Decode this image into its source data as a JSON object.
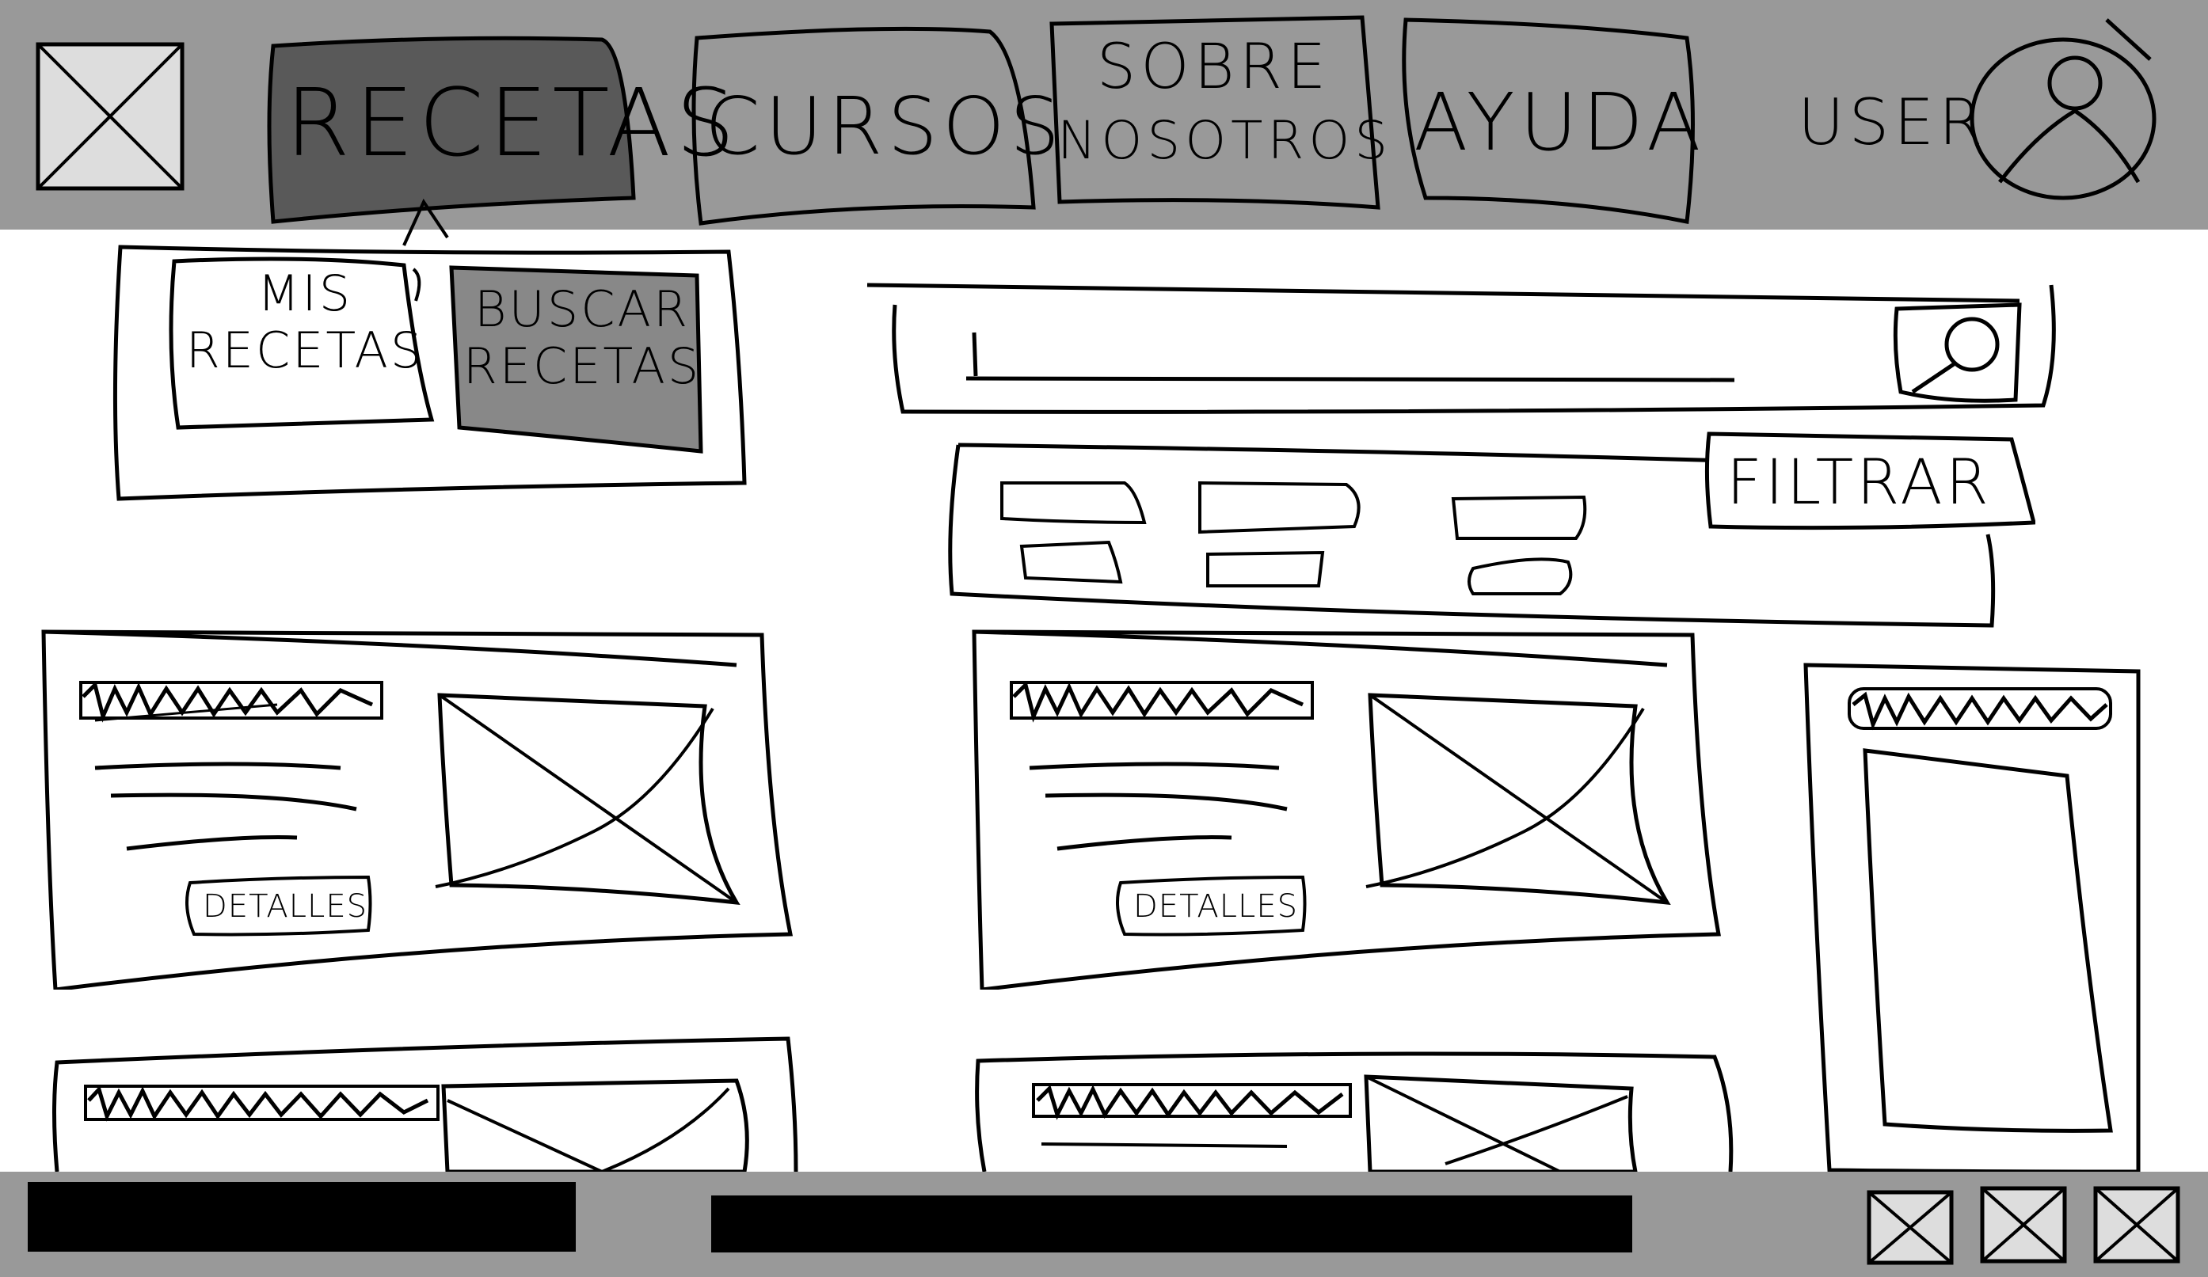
{
  "header": {
    "logo_icon": "image-placeholder-icon",
    "nav": [
      {
        "id": "recetas",
        "label": "RECETAS",
        "active": true
      },
      {
        "id": "cursos",
        "label": "CURSOS",
        "active": false
      },
      {
        "id": "sobre",
        "label_line1": "SOBRE",
        "label_line2": "NOSOTROS",
        "active": false
      },
      {
        "id": "ayuda",
        "label": "AYUDA",
        "active": false
      }
    ],
    "user_label": "USER",
    "user_icon": "user-avatar-icon"
  },
  "dropdown": {
    "items": [
      {
        "label_line1": "MIS",
        "label_line2": "RECETAS",
        "selected": false
      },
      {
        "label_line1": "BUSCAR",
        "label_line2": "RECETAS",
        "selected": true
      }
    ]
  },
  "search": {
    "value": "",
    "search_icon": "search-icon"
  },
  "filter": {
    "button_label": "FILTRAR"
  },
  "cards": [
    {
      "button_label": "DETALLES"
    },
    {
      "button_label": "DETALLES"
    }
  ],
  "footer": {
    "icons": [
      "image-placeholder-icon",
      "image-placeholder-icon",
      "image-placeholder-icon"
    ]
  },
  "colors": {
    "bar_gray": "#999999",
    "active_tab": "#595959",
    "selected_item": "#888888",
    "placeholder_fill": "#dddddd",
    "ink": "#000000"
  }
}
